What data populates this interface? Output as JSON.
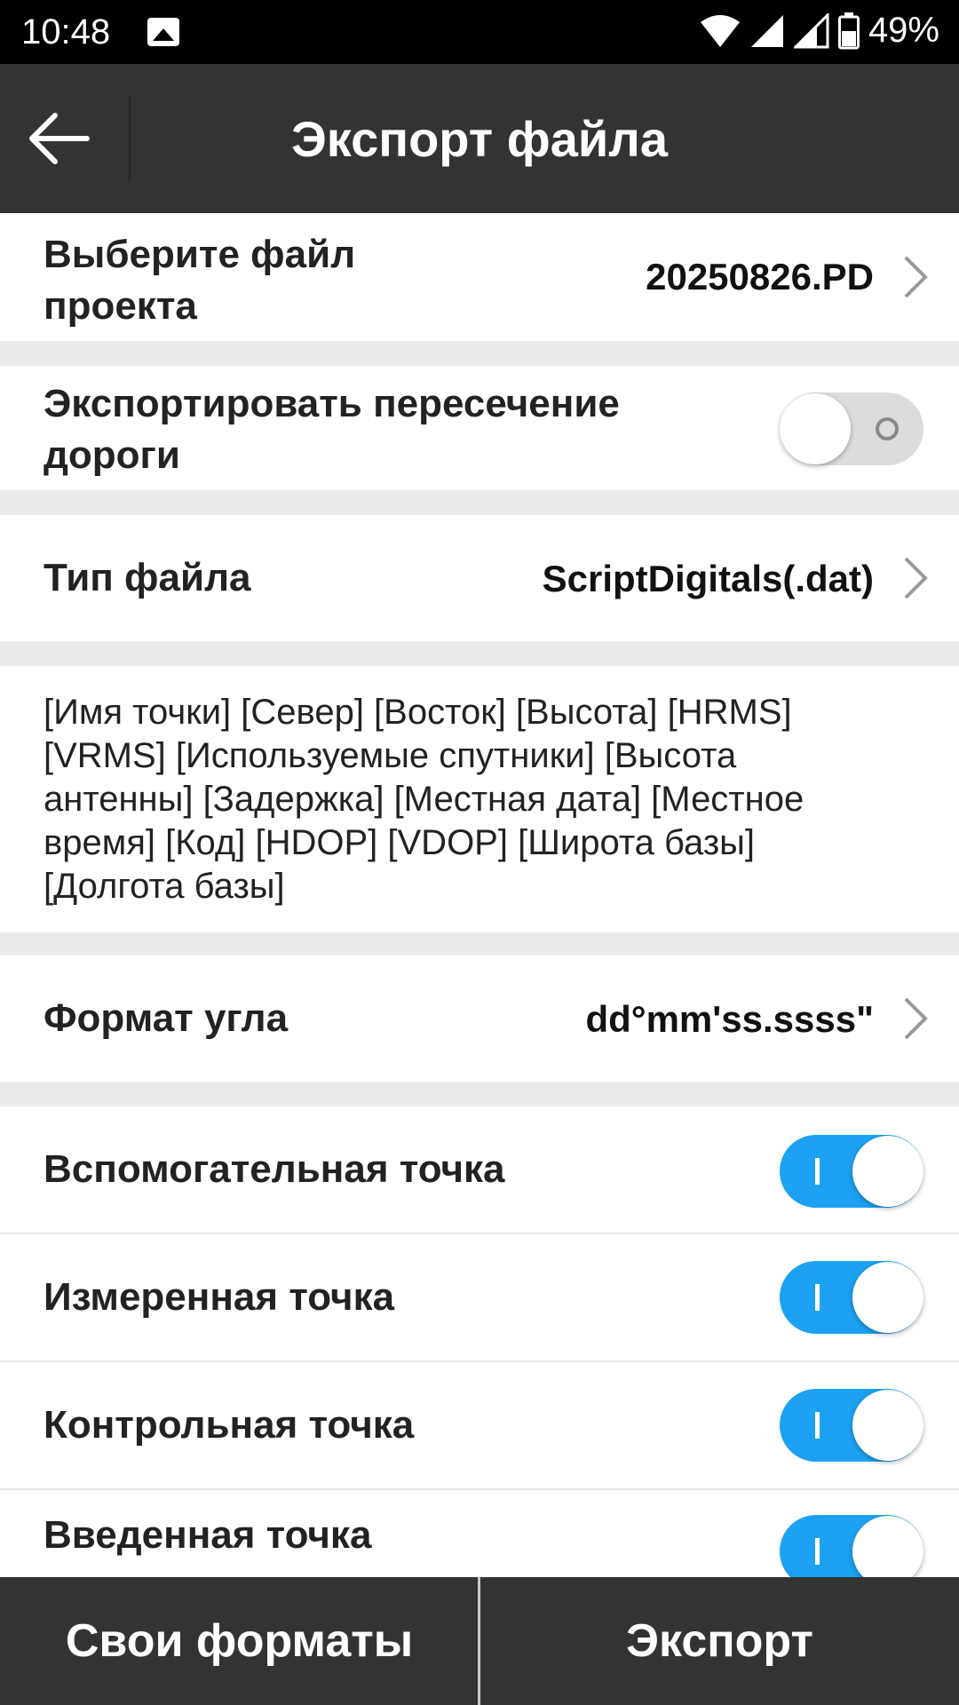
{
  "status_bar": {
    "time": "10:48",
    "battery_percent": "49%",
    "icons": [
      "image-icon",
      "wifi-icon",
      "signal-icon",
      "signal-icon-2",
      "battery-icon"
    ]
  },
  "app_bar": {
    "title": "Экспорт файла",
    "back_icon": "arrow-left-icon"
  },
  "rows": {
    "project_file": {
      "label": "Выберите файл проекта",
      "value": "20250826.PD"
    },
    "export_road": {
      "label": "Экспортировать пересечение дороги",
      "enabled": false
    },
    "file_type": {
      "label": "Тип файла",
      "value": "ScriptDigitals(.dat)"
    },
    "fields_description": "[Имя точки] [Север] [Восток] [Высота] [HRMS] [VRMS] [Используемые спутники] [Высота антенны] [Задержка] [Местная дата] [Местное время] [Код] [HDOP] [VDOP] [Широта базы] [Долгота базы]",
    "angle_format": {
      "label": "Формат угла",
      "value": "dd°mm'ss.ssss\""
    },
    "auxiliary_point": {
      "label": "Вспомогательная точка",
      "enabled": true
    },
    "measured_point": {
      "label": "Измеренная точка",
      "enabled": true
    },
    "control_point": {
      "label": "Контрольная точка",
      "enabled": true
    },
    "entered_point": {
      "label": "Введенная точка",
      "enabled": true
    }
  },
  "bottom_bar": {
    "custom_formats_label": "Свои форматы",
    "export_label": "Экспорт"
  },
  "colors": {
    "app_bar": "#333333",
    "toggle_on": "#1da1f2",
    "toggle_off": "#dcdcdc",
    "section_gap": "#ebebeb"
  }
}
